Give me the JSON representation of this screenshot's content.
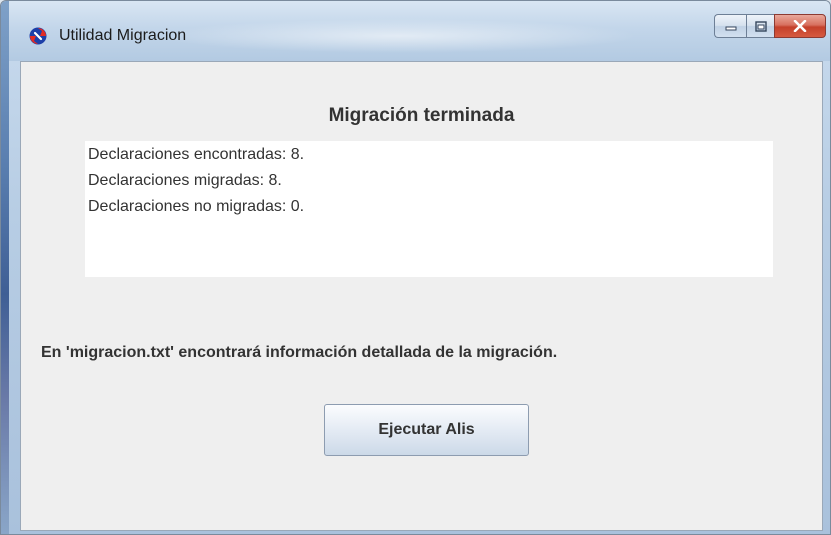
{
  "window": {
    "title": "Utilidad Migracion",
    "icon": "migration-app-icon",
    "controls": [
      "minimize-icon",
      "maximize-icon",
      "close-icon"
    ]
  },
  "main": {
    "heading": "Migración terminada",
    "stats": [
      "Declaraciones encontradas: 8.",
      "Declaraciones migradas: 8.",
      "Declaraciones no migradas: 0."
    ],
    "info": "En 'migracion.txt' encontrará información detallada de la migración.",
    "run_button_label": "Ejecutar Alis"
  },
  "colors": {
    "client_background": "#efefef",
    "close_button": "#c4402b",
    "text": "#333333"
  }
}
